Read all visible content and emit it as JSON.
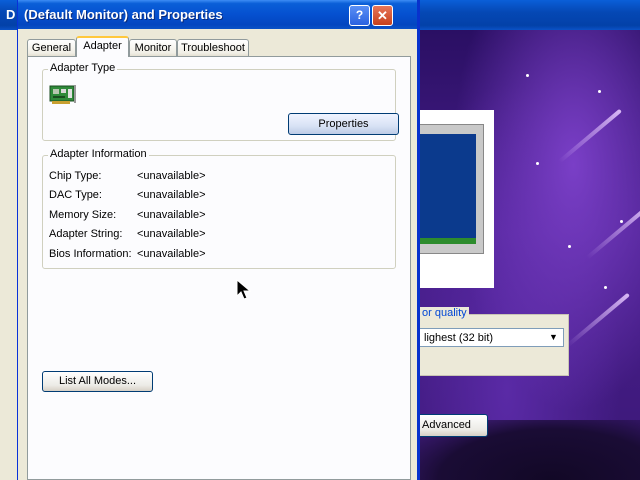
{
  "background_window": {
    "title_letter": "D",
    "color_quality": {
      "label": "or quality",
      "selected": "lighest (32 bit)"
    },
    "advanced_button": "Advanced"
  },
  "dialog": {
    "title": "(Default Monitor) and  Properties",
    "help_glyph": "?",
    "close_glyph": "✕",
    "tabs": [
      {
        "label": "General",
        "active": false
      },
      {
        "label": "Adapter",
        "active": true
      },
      {
        "label": "Monitor",
        "active": false
      },
      {
        "label": "Troubleshoot",
        "active": false
      }
    ],
    "adapter_type": {
      "group_label": "Adapter Type",
      "icon": "video-card-icon",
      "properties_button": "Properties"
    },
    "adapter_information": {
      "group_label": "Adapter Information",
      "rows": [
        {
          "label": "Chip Type:",
          "value": "<unavailable>"
        },
        {
          "label": "DAC Type:",
          "value": "<unavailable>"
        },
        {
          "label": "Memory Size:",
          "value": "<unavailable>"
        },
        {
          "label": "Adapter String:",
          "value": "<unavailable>"
        },
        {
          "label": "Bios Information:",
          "value": "<unavailable>"
        }
      ]
    },
    "list_all_modes_button": "List All Modes..."
  },
  "colors": {
    "title_bar_blue": "#0550d0",
    "tab_highlight": "#ffc83c",
    "dialog_face": "#ece9d8"
  }
}
